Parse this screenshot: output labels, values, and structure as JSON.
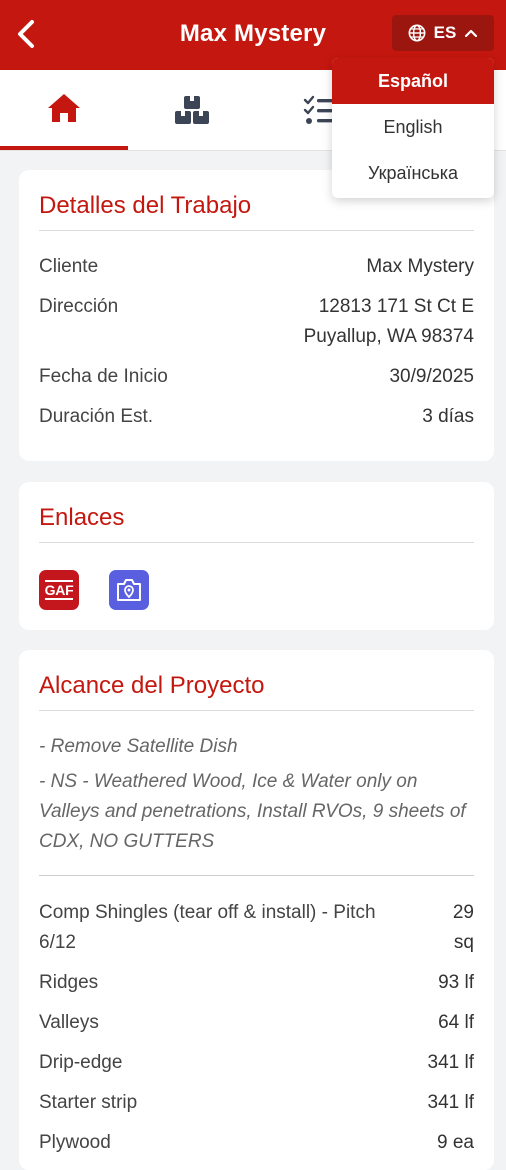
{
  "header": {
    "title": "Max Mystery",
    "lang_code": "ES"
  },
  "language_menu": {
    "options": [
      {
        "label": "Español",
        "selected": true
      },
      {
        "label": "English",
        "selected": false
      },
      {
        "label": "Українська",
        "selected": false
      }
    ]
  },
  "tabs": [
    {
      "icon": "home-icon",
      "active": true
    },
    {
      "icon": "materials-icon",
      "active": false
    },
    {
      "icon": "checklist-icon",
      "active": false
    }
  ],
  "details": {
    "title": "Detalles del Trabajo",
    "client_label": "Cliente",
    "client_value": "Max Mystery",
    "address_label": "Dirección",
    "address_line1": "12813 171 St Ct E",
    "address_line2": "Puyallup, WA 98374",
    "start_label": "Fecha de Inicio",
    "start_value": "30/9/2025",
    "duration_label": "Duración Est.",
    "duration_value": "3 días"
  },
  "links": {
    "title": "Enlaces",
    "gaf_label": "GAF",
    "colors": {
      "gaf": "#c4171d",
      "camera": "#5a5fe0"
    }
  },
  "scope": {
    "title": "Alcance del Proyecto",
    "note1": "- Remove Satellite Dish",
    "note2_line1": "- NS - Weathered Wood, Ice & Water only on",
    "note2_line2": "Valleys and penetrations, Install RVOs, 9 sheets of",
    "note2_line3": "CDX, NO GUTTERS",
    "items": [
      {
        "label_l1": "Comp Shingles (tear off & install) - Pitch",
        "label_l2": "6/12",
        "val_l1": "29",
        "val_l2": "sq"
      },
      {
        "label_l1": "Ridges",
        "val_l1": "93 lf"
      },
      {
        "label_l1": "Valleys",
        "val_l1": "64 lf"
      },
      {
        "label_l1": "Drip-edge",
        "val_l1": "341 lf"
      },
      {
        "label_l1": "Starter strip",
        "val_l1": "341 lf"
      },
      {
        "label_l1": "Plywood",
        "val_l1": "9 ea"
      }
    ]
  },
  "colors": {
    "brand": "#c4170f",
    "brand_dark": "#9c1610",
    "background": "#f2f3f5"
  }
}
